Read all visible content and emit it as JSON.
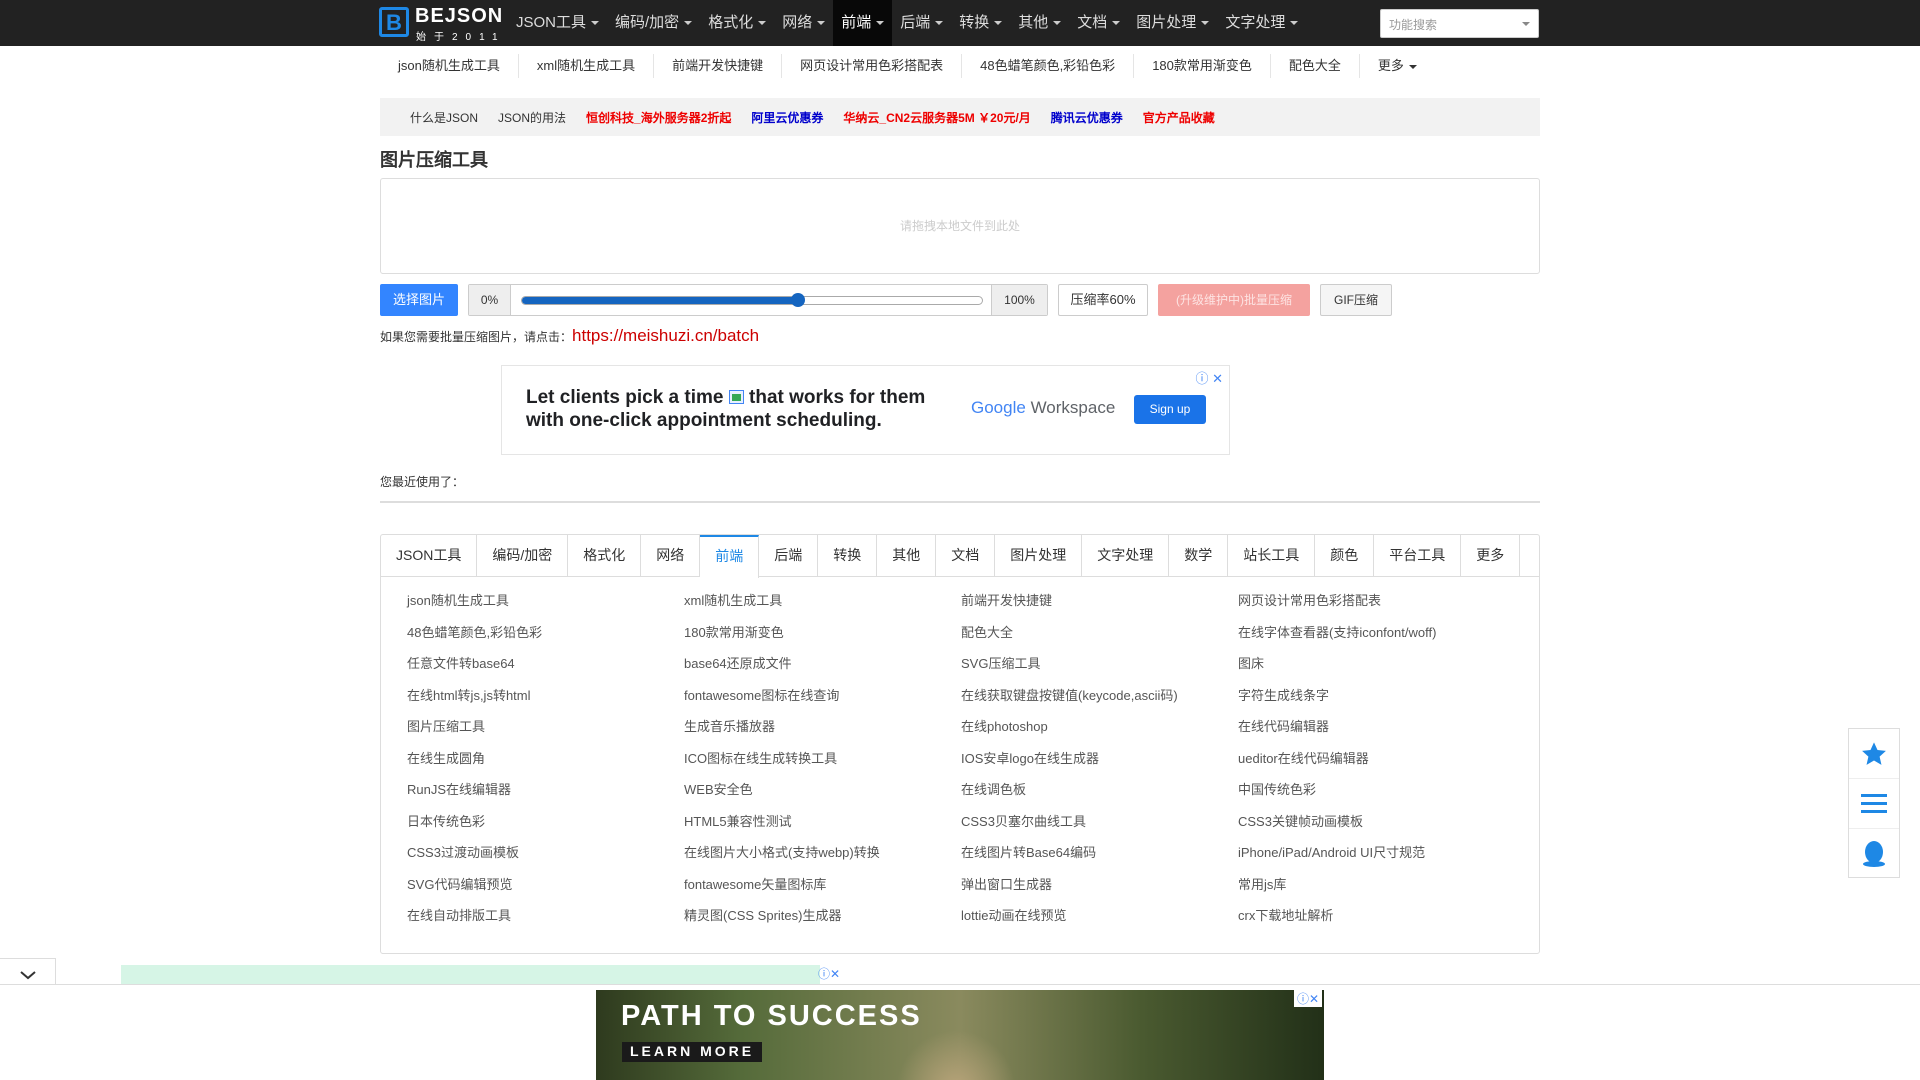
{
  "logo": {
    "mark": "B",
    "name": "BEJSON",
    "sub": "始于2011"
  },
  "nav": {
    "items": [
      {
        "label": "JSON工具"
      },
      {
        "label": "编码/加密"
      },
      {
        "label": "格式化"
      },
      {
        "label": "网络"
      },
      {
        "label": "前端",
        "active": true
      },
      {
        "label": "后端"
      },
      {
        "label": "转换"
      },
      {
        "label": "其他"
      },
      {
        "label": "文档"
      },
      {
        "label": "图片处理"
      },
      {
        "label": "文字处理"
      }
    ],
    "search_placeholder": "功能搜索"
  },
  "subnav": [
    "json随机生成工具",
    "xml随机生成工具",
    "前端开发快捷键",
    "网页设计常用色彩搭配表",
    "48色蜡笔颜色,彩铅色彩",
    "180款常用渐变色",
    "配色大全",
    "更多"
  ],
  "adbar": [
    {
      "text": "什么是JSON",
      "style": "plain"
    },
    {
      "text": "JSON的用法",
      "style": "plain"
    },
    {
      "text": "恒创科技_海外服务器2折起",
      "style": "red"
    },
    {
      "text": "阿里云优惠券",
      "style": "blue"
    },
    {
      "text": "华纳云_CN2云服务器5M ￥20元/月",
      "style": "red"
    },
    {
      "text": "腾讯云优惠券",
      "style": "blue"
    },
    {
      "text": "官方产品收藏",
      "style": "red"
    }
  ],
  "page": {
    "title": "图片压缩工具",
    "dropzone": "请拖拽本地文件到此处",
    "select_button": "选择图片",
    "slider_min": "0%",
    "slider_max": "100%",
    "slider_value": 0.6,
    "rate_button": "压缩率60%",
    "batch_button": "(升级维护中)批量压缩",
    "gif_button": "GIF压缩",
    "batch_note": "如果您需要批量压缩图片，请点击：",
    "batch_link": "https://meishuzi.cn/batch",
    "recent_label": "您最近使用了："
  },
  "google_ad": {
    "line1": "Let clients pick a time",
    "line1b": "that works for them",
    "line2": "with one-click appointment scheduling.",
    "brand": "Google",
    "product": "Workspace",
    "cta": "Sign up"
  },
  "tabs": [
    "JSON工具",
    "编码/加密",
    "格式化",
    "网络",
    "前端",
    "后端",
    "转换",
    "其他",
    "文档",
    "图片处理",
    "文字处理",
    "数学",
    "站长工具",
    "颜色",
    "平台工具",
    "更多"
  ],
  "active_tab": "前端",
  "tools": [
    "json随机生成工具",
    "xml随机生成工具",
    "前端开发快捷键",
    "网页设计常用色彩搭配表",
    "48色蜡笔颜色,彩铅色彩",
    "180款常用渐变色",
    "配色大全",
    "在线字体查看器(支持iconfont/woff)",
    "任意文件转base64",
    "base64还原成文件",
    "SVG压缩工具",
    "图床",
    "在线html转js,js转html",
    "fontawesome图标在线查询",
    "在线获取键盘按键值(keycode,ascii码)",
    "字符生成线条字",
    "图片压缩工具",
    "生成音乐播放器",
    "在线photoshop",
    "在线代码编辑器",
    "在线生成圆角",
    "ICO图标在线生成转换工具",
    "IOS安卓logo在线生成器",
    "ueditor在线代码编辑器",
    "RunJS在线编辑器",
    "WEB安全色",
    "在线调色板",
    "中国传统色彩",
    "日本传统色彩",
    "HTML5兼容性测试",
    "CSS3贝塞尔曲线工具",
    "CSS3关键帧动画模板",
    "CSS3过渡动画模板",
    "在线图片大小格式(支持webp)转换",
    "在线图片转Base64编码",
    "iPhone/iPad/Android UI尺寸规范",
    "SVG代码编辑预览",
    "fontawesome矢量图标库",
    "弹出窗口生成器",
    "常用js库",
    "在线自动排版工具",
    "精灵图(CSS Sprites)生成器",
    "lottie动画在线预览",
    "crx下载地址解析"
  ],
  "bottom_ad": {
    "headline": "PATH TO SUCCESS",
    "cta": "LEARN MORE"
  },
  "colors": {
    "accent": "#1e88e5",
    "topbar": "#222222",
    "link_red": "#cc0000"
  }
}
